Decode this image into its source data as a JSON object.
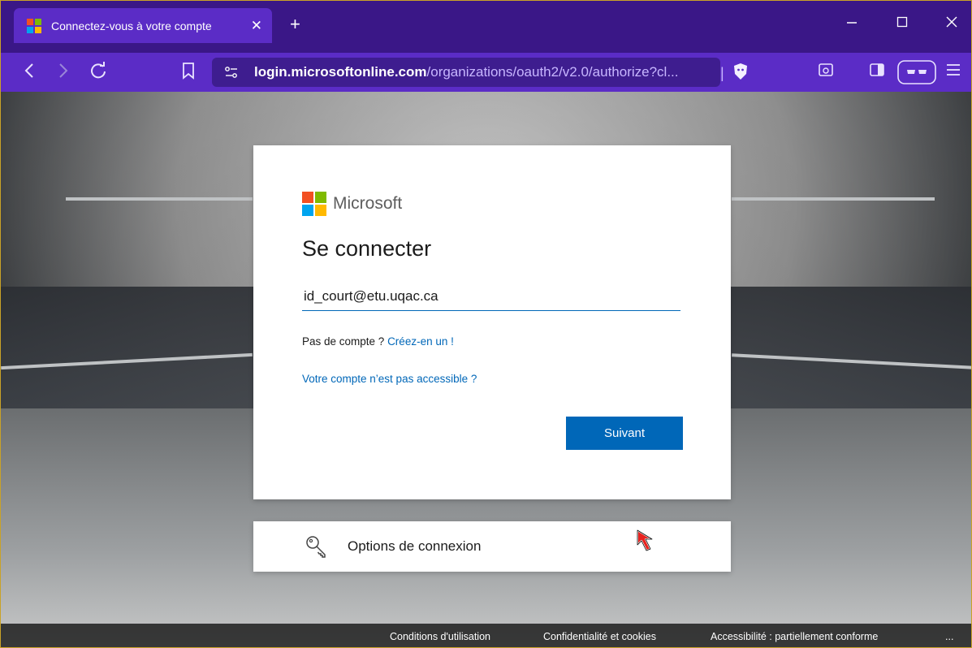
{
  "browser": {
    "tab_title": "Connectez-vous à votre compte",
    "tab_close": "✕",
    "new_tab": "+",
    "url_host": "login.microsoftonline.com",
    "url_path": "/organizations/oauth2/v2.0/authorize?cl...",
    "icons": [
      "back-icon",
      "forward-icon",
      "reload-icon",
      "bookmark-icon",
      "site-settings-icon",
      "brave-shield-icon",
      "tab-search-icon",
      "sidebar-icon",
      "reader-mode-icon",
      "menu-icon",
      "minimize-icon",
      "maximize-icon",
      "close-icon"
    ]
  },
  "colors": {
    "brand_blue": "#0067b8",
    "ms_red": "#f25022",
    "ms_green": "#7fba00",
    "ms_blue": "#00a4ef",
    "ms_yellow": "#ffb900",
    "browser_purple": "#5b2cc6"
  },
  "signin": {
    "brand": "Microsoft",
    "title": "Se connecter",
    "email_value": "id_court@etu.uqac.ca",
    "no_account_text": "Pas de compte ? ",
    "create_link": "Créez-en un !",
    "cant_access_link": "Votre compte n’est pas accessible ?",
    "next_button": "Suivant"
  },
  "options": {
    "label": "Options de connexion"
  },
  "footer": {
    "terms": "Conditions d'utilisation",
    "privacy": "Confidentialité et cookies",
    "accessibility": "Accessibilité : partiellement conforme",
    "more": "..."
  }
}
